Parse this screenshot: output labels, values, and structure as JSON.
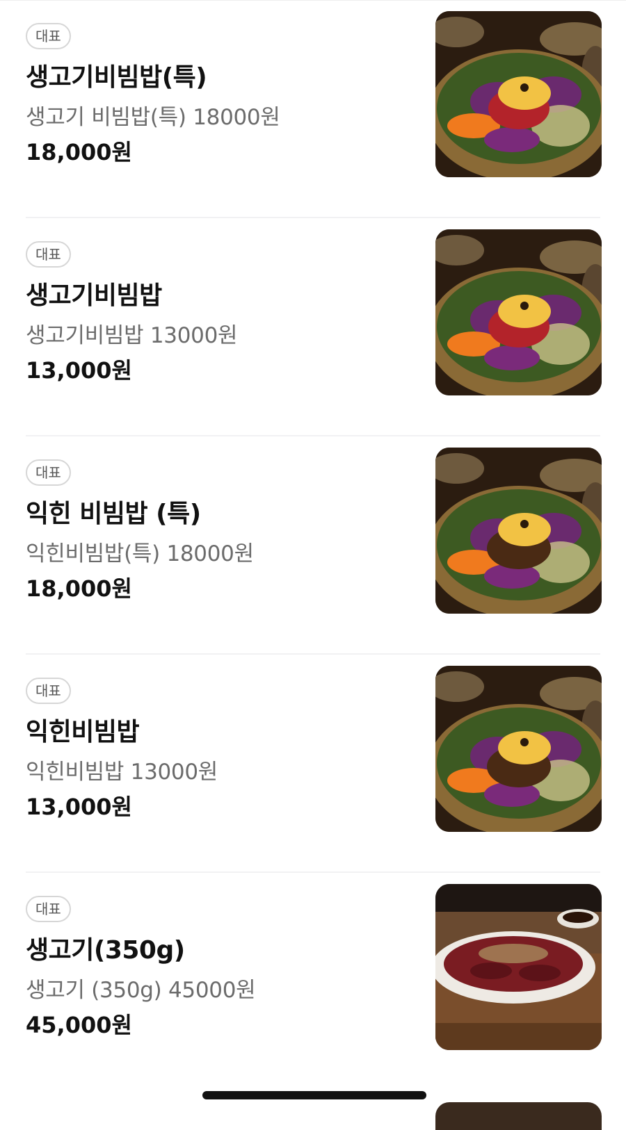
{
  "menu": {
    "items": [
      {
        "badge": "대표",
        "name": "생고기비빔밥(특)",
        "description": "생고기 비빔밥(특) 18000원",
        "price": "18,000원",
        "image": "raw-beef-bibimbap-photo"
      },
      {
        "badge": "대표",
        "name": "생고기비빔밥",
        "description": "생고기비빔밥 13000원",
        "price": "13,000원",
        "image": "raw-beef-bibimbap-photo"
      },
      {
        "badge": "대표",
        "name": "익힌 비빔밥 (특)",
        "description": "익힌비빔밥(특) 18000원",
        "price": "18,000원",
        "image": "cooked-beef-bibimbap-photo"
      },
      {
        "badge": "대표",
        "name": "익힌비빔밥",
        "description": "익힌비빔밥 13000원",
        "price": "13,000원",
        "image": "cooked-beef-bibimbap-photo"
      },
      {
        "badge": "대표",
        "name": "생고기(350g)",
        "description": "생고기 (350g) 45000원",
        "price": "45,000원",
        "image": "raw-beef-plate-photo"
      }
    ]
  }
}
